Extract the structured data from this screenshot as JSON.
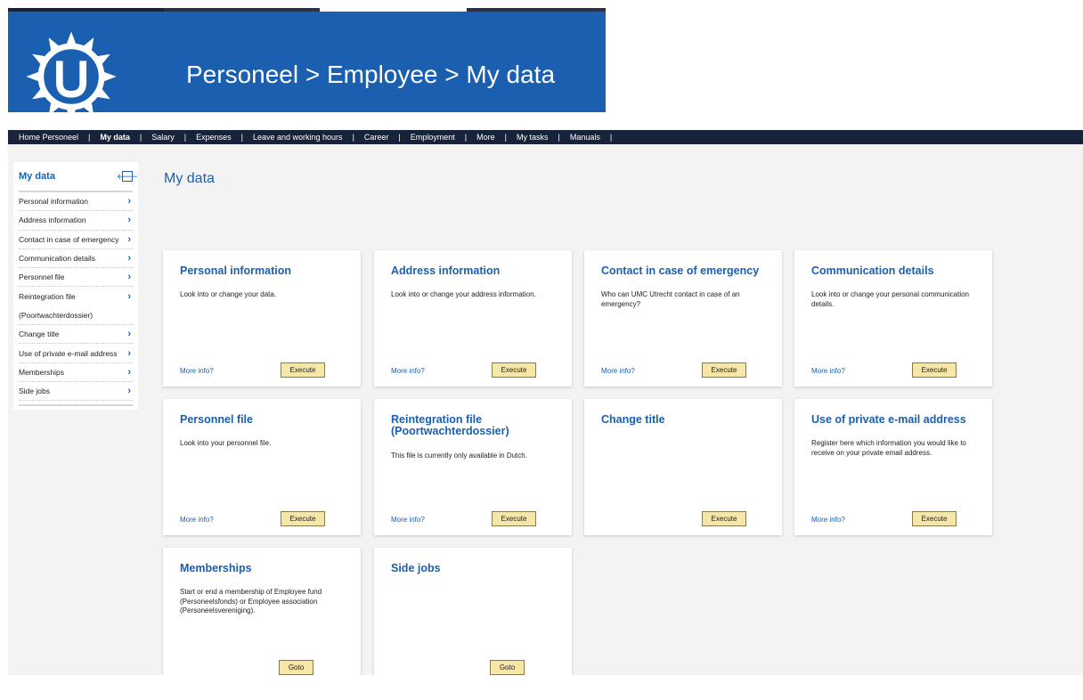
{
  "banner": {
    "breadcrumb": "Personeel > Employee > My data",
    "logo_icon": "umc-utrecht-sun-logo",
    "color": "#1a5fb0"
  },
  "topnav": {
    "items": [
      {
        "label": "Home Personeel",
        "active": false
      },
      {
        "label": "My data",
        "active": true
      },
      {
        "label": "Salary",
        "active": false
      },
      {
        "label": "Expenses",
        "active": false
      },
      {
        "label": "Leave and working hours",
        "active": false
      },
      {
        "label": "Career",
        "active": false
      },
      {
        "label": "Employment",
        "active": false
      },
      {
        "label": "More",
        "active": false
      },
      {
        "label": "My tasks",
        "active": false
      },
      {
        "label": "Manuals",
        "active": false
      }
    ],
    "separator": "|"
  },
  "sidebar": {
    "title": "My data",
    "collapse_icon": "collapse-left-arrow-icon",
    "items": [
      {
        "label": "Personal information"
      },
      {
        "label": "Address information"
      },
      {
        "label": "Contact in case of emergency"
      },
      {
        "label": "Communication details"
      },
      {
        "label": "Personnel file"
      },
      {
        "label": "Reintegration file"
      },
      {
        "label": "(Poortwachterdossier)"
      },
      {
        "label": "Change title"
      },
      {
        "label": "Use of private e-mail address"
      },
      {
        "label": "Memberships"
      },
      {
        "label": "Side jobs"
      }
    ]
  },
  "main": {
    "title": "My data",
    "more_info": "More info?",
    "execute": "Execute",
    "goto": "Goto",
    "cards": [
      {
        "title": "Personal information",
        "desc": "Look into or change your data."
      },
      {
        "title": "Address information",
        "desc": "Look into or change your address information."
      },
      {
        "title": "Contact in case of emergency",
        "desc": "Who can UMC Utrecht contact in case of an emergency?"
      },
      {
        "title": "Communication details",
        "desc": "Look into or change your personal communication details."
      },
      {
        "title": "Personnel file",
        "desc": "Look into your personnel file."
      },
      {
        "title": "Reintegration file (Poortwachterdossier)",
        "desc": "This file is currently only available in Dutch."
      },
      {
        "title": "Change title",
        "desc": ""
      },
      {
        "title": "Use of private e-mail address",
        "desc": "Register here which information you would like to receive on your private email address."
      },
      {
        "title": "Memberships",
        "desc": "Start or end a membership of Employee fund (Personeelsfonds) or Employee association (Personeelsvereniging)."
      },
      {
        "title": "Side jobs",
        "desc": ""
      }
    ]
  },
  "colors": {
    "accent": "#1a5fb0",
    "nav_bg": "#17233a",
    "button_bg": "#f6e7a8",
    "content_bg": "#f3f3f3"
  }
}
